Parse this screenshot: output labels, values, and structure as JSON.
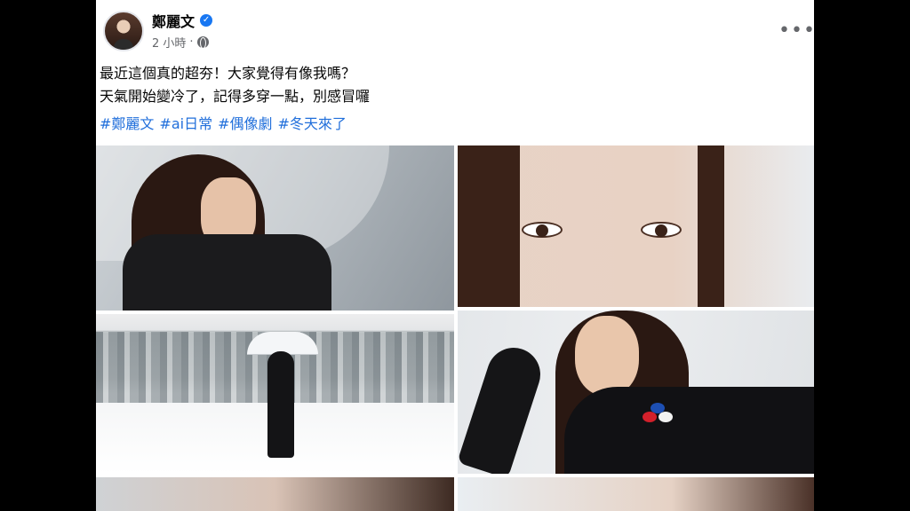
{
  "post": {
    "author": "鄭麗文",
    "verified": true,
    "time": "2 小時",
    "privacy_icon": "globe-icon",
    "more_icon": "more-options-icon",
    "text_lines": [
      "最近這個真的超夯！大家覺得有像我嗎？",
      "天氣開始變冷了，記得多穿一點，別感冒囉"
    ],
    "hashtags": [
      "#鄭麗文",
      "#ai日常",
      "#偶像劇",
      "#冬天來了"
    ],
    "link_color": "#216fdb",
    "verified_color": "#1877f2"
  }
}
